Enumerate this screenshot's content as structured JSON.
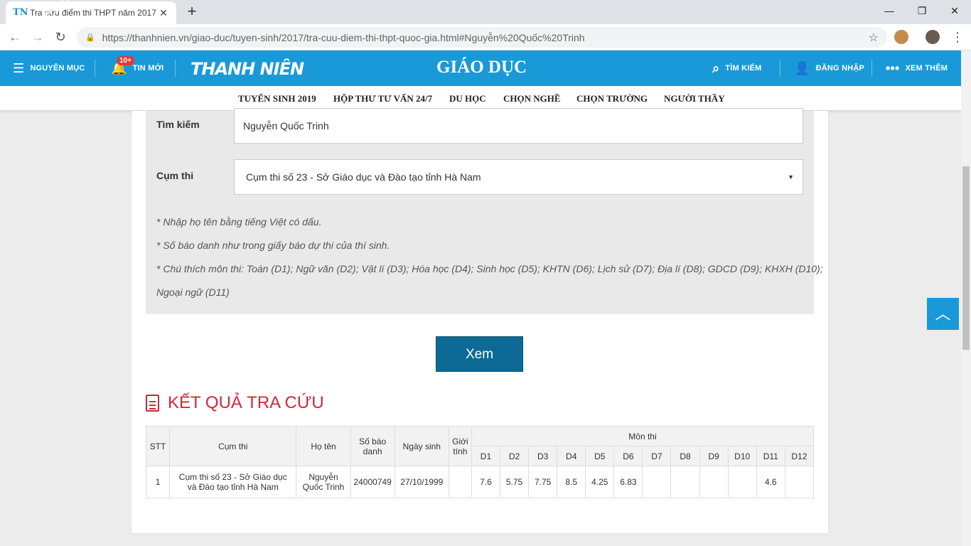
{
  "browser": {
    "tab_title": "Tra cứu điểm thi THPT năm 2017",
    "tab_icon": "TN",
    "url": "https://thanhnien.vn/giao-duc/tuyen-sinh/2017/tra-cuu-diem-thi-thpt-quoc-gia.html#Nguyễn%20Quốc%20Trinh"
  },
  "header": {
    "menu_label": "NGUYÊN MỤC",
    "watermark": "tuyensinhsaocom",
    "notif_badge": "10+",
    "news_label": "TIN MỚI",
    "logo": "THANH NIÊN",
    "section": "GIÁO DỤC",
    "search_label": "TÌM KIẾM",
    "login_label": "ĐĂNG NHẬP",
    "more_label": "XEM THÊM"
  },
  "subnav": [
    "TUYỂN SINH 2019",
    "HỘP THƯ TƯ VẤN 24/7",
    "DU HỌC",
    "CHỌN NGHỀ",
    "CHỌN TRƯỜNG",
    "NGƯỜI THẦY"
  ],
  "form": {
    "search_label": "Tìm kiếm",
    "search_value": "Nguyễn Quốc Trinh",
    "cluster_label": "Cụm thi",
    "cluster_value": "Cụm thi số 23 - Sở Giáo dục và Đào tạo tỉnh Hà Nam",
    "note1": "* Nhập họ tên bằng tiếng Việt có dấu.",
    "note2": "* Số báo danh như trong giấy báo dự thi của thí sinh.",
    "note3": "* Chú thích môn thi: Toán (D1); Ngữ văn (D2); Vật lí (D3); Hóa học (D4); Sinh học (D5); KHTN (D6); Lịch sử (D7); Địa lí (D8); GDCD (D9); KHXH (D10);",
    "note4": "Ngoại ngữ (D11)",
    "submit": "Xem"
  },
  "result": {
    "title": "KẾT QUẢ TRA CỨU",
    "headers": {
      "stt": "STT",
      "cluster": "Cụm thi",
      "name": "Họ tên",
      "sbd": "Số báo danh",
      "dob": "Ngày sinh",
      "gender": "Giới tính",
      "subjects": "Môn thi",
      "cols": [
        "D1",
        "D2",
        "D3",
        "D4",
        "D5",
        "D6",
        "D7",
        "D8",
        "D9",
        "D10",
        "D11",
        "D12"
      ]
    },
    "rows": [
      {
        "stt": "1",
        "cluster": "Cụm thi số 23 - Sở Giáo dục và Đào tạo tỉnh Hà Nam",
        "name": "Nguyễn Quốc Trinh",
        "sbd": "24000749",
        "dob": "27/10/1999",
        "gender": "",
        "scores": [
          "7.6",
          "5.75",
          "7.75",
          "8.5",
          "4.25",
          "6.83",
          "",
          "",
          "",
          "",
          "4.6",
          ""
        ]
      }
    ]
  },
  "colors": {
    "brand": "#1a99d8",
    "button": "#0d6a96",
    "result_title": "#d0283a"
  }
}
